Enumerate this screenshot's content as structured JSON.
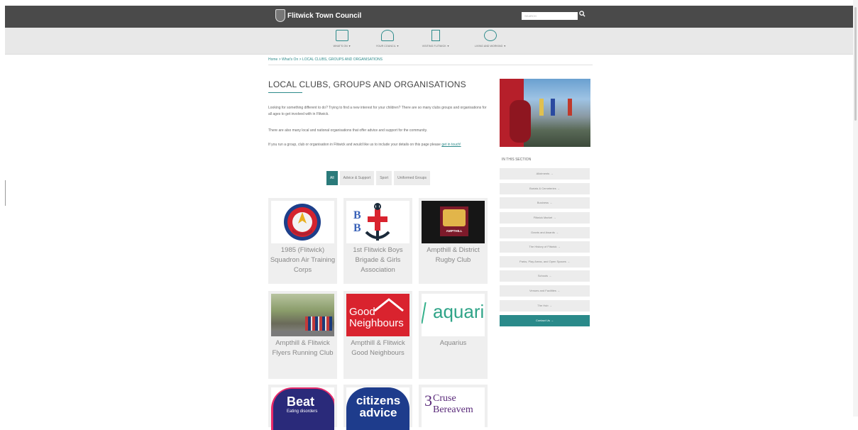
{
  "header": {
    "site_title": "Flitwick Town Council",
    "search_placeholder": "SEARCH",
    "search_icon": "search-icon"
  },
  "nav": [
    {
      "label": "WHAT'S ON ▼",
      "icon": "calendar-icon"
    },
    {
      "label": "YOUR COUNCIL ▼",
      "icon": "people-icon"
    },
    {
      "label": "VISITING FLITWICK ▼",
      "icon": "signpost-icon"
    },
    {
      "label": "LIVING AND WORKING ▼",
      "icon": "community-icon"
    }
  ],
  "breadcrumb": "Home > What's On > LOCAL CLUBS, GROUPS AND ORGANISATIONS",
  "page_title": "LOCAL CLUBS, GROUPS AND ORGANISATIONS",
  "intro": {
    "p1": "Looking for something different to do? Trying to find a new interest for your children? There are so many clubs groups and organisations for all ages to get involved with in Flitwick.",
    "p2": "There are also many local and national organisations that offer advice and support for the community.",
    "p3_text": "If you run a group, club or organisation in Flitwick and would like us to include your details on this page please",
    "p3_link": "get in touch!"
  },
  "filters": [
    "All",
    "Advice & Support",
    "Sport",
    "Uniformed Groups"
  ],
  "cards": [
    {
      "name": "1985 (Flitwick) Squadron Air Training Corps"
    },
    {
      "name": "1st Flitwick Boys Brigade & Girls Association",
      "logo_text": "B B"
    },
    {
      "name": "Ampthill & District Rugby Club",
      "logo_text": "AMPTHILL"
    },
    {
      "name": "Ampthill & Flitwick Flyers Running Club"
    },
    {
      "name": "Ampthill & Flitwick Good Neighbours",
      "logo_text": "Good Neighbours"
    },
    {
      "name": "Aquarius",
      "logo_text": "aquari"
    },
    {
      "name": "",
      "logo_text": "Beat",
      "logo_sub": "Eating disorders"
    },
    {
      "name": "",
      "logo_text": "citizens advice"
    },
    {
      "name": "",
      "logo_text": "Cruse Bereavem"
    }
  ],
  "sidebar": {
    "heading": "IN THIS SECTION",
    "links": [
      "Allotments →",
      "Burials & Cemeteries →",
      "Business →",
      "Flitwick Market →",
      "Grants and Awards →",
      "The History of Flitwick →",
      "Parks, Play Areas, and Open Spaces →",
      "Schools →",
      "Venues and Facilities →",
      "The Hub →",
      "Contact Us →"
    ]
  },
  "colors": {
    "header_bg": "#4a4a4a",
    "accent": "#2e8b8b",
    "active_link": "#2a8a8a"
  }
}
